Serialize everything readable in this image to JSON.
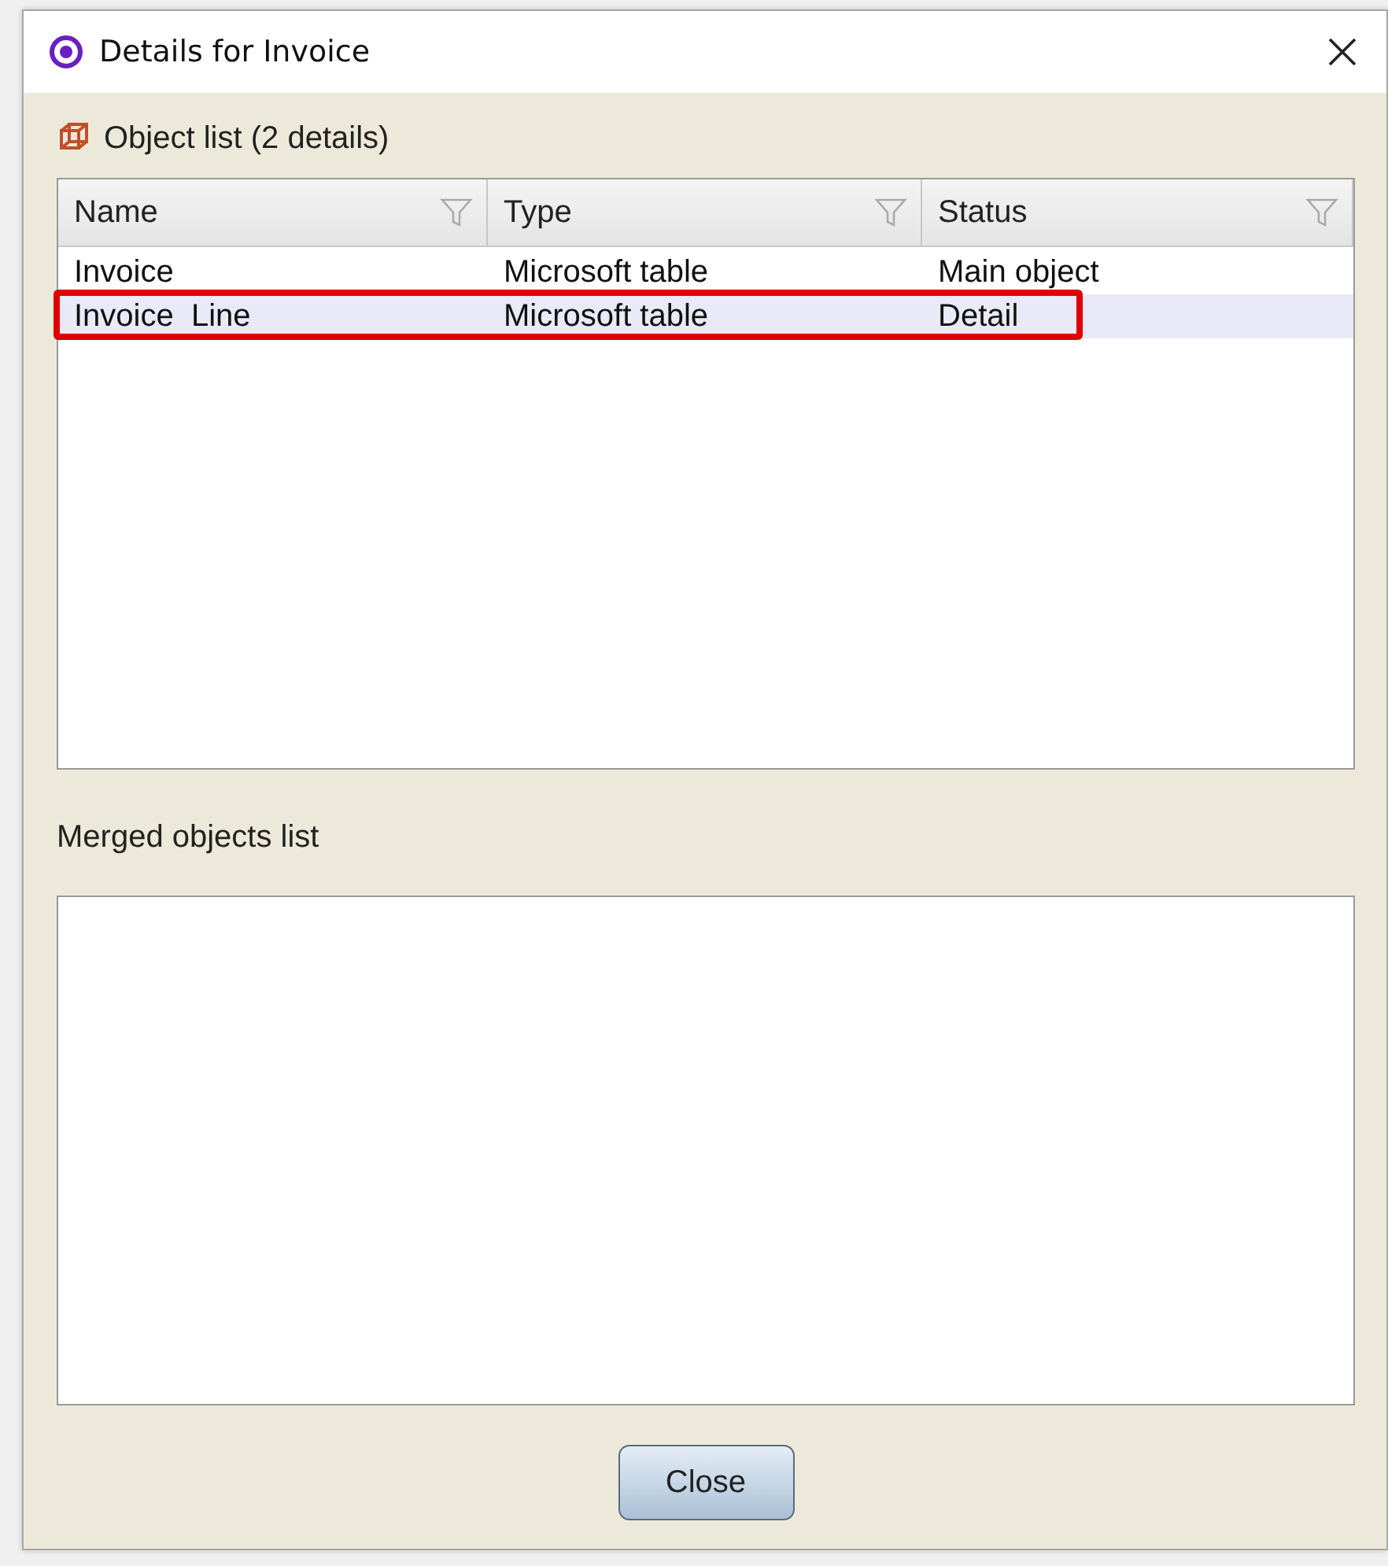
{
  "window": {
    "title": "Details for Invoice"
  },
  "object_list": {
    "label": "Object list (2 details)",
    "columns": [
      {
        "label": "Name"
      },
      {
        "label": "Type"
      },
      {
        "label": "Status"
      }
    ],
    "rows": [
      {
        "cells": [
          "Invoice",
          "Microsoft table",
          "Main object"
        ],
        "selected": false,
        "marked": false
      },
      {
        "cells": [
          "Invoice  Line",
          "Microsoft table",
          "Detail"
        ],
        "selected": true,
        "marked": true
      }
    ]
  },
  "merged_list": {
    "label": "Merged objects list"
  },
  "buttons": [
    {
      "label": "Close"
    }
  ]
}
